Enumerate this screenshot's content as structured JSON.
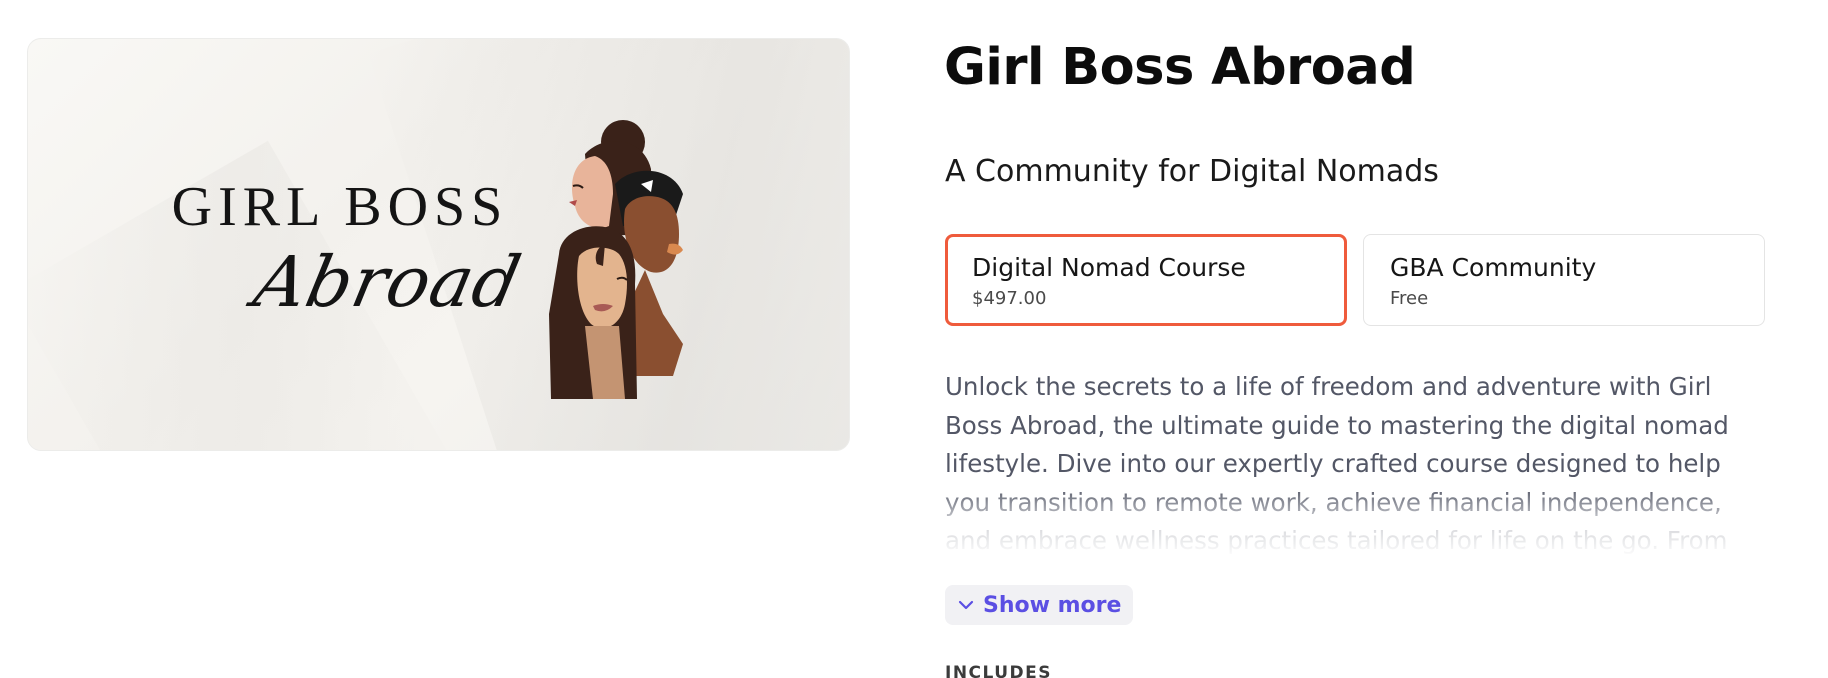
{
  "product": {
    "title": "Girl Boss Abroad",
    "subtitle": "A Community for Digital Nomads"
  },
  "hero": {
    "logo_line1": "GIRL BOSS",
    "logo_line2": "Abroad"
  },
  "options": [
    {
      "name": "Digital Nomad Course",
      "price": "$497.00",
      "selected": true
    },
    {
      "name": "GBA Community",
      "price": "Free",
      "selected": false
    }
  ],
  "description": "Unlock the secrets to a life of freedom and adventure with Girl Boss Abroad, the ultimate guide to mastering the digital nomad lifestyle. Dive into our expertly crafted course designed to help you transition to remote work, achieve financial independence, and embrace wellness practices tailored for life on the go. From finding the perfect",
  "show_more": {
    "label": "Show more",
    "icon": "chevron-down-icon"
  },
  "includes_heading": "INCLUDES",
  "colors": {
    "selected_border": "#ef5b3c",
    "link": "#5b4fe3",
    "body_text": "#535766"
  }
}
